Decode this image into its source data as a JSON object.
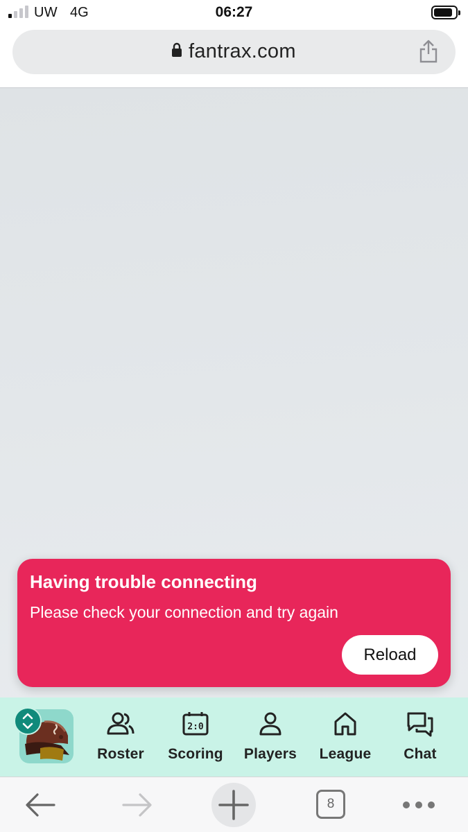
{
  "status_bar": {
    "carrier": "UW",
    "network": "4G",
    "time": "06:27",
    "signal_bars_active": 1,
    "signal_bars_total": 4,
    "battery_level": 0.85
  },
  "browser": {
    "url": "fantrax.com",
    "tab_count": "8"
  },
  "error_toast": {
    "title": "Having trouble connecting",
    "message": "Please check your connection and try again",
    "reload_label": "Reload",
    "color": "#e8265a"
  },
  "app_nav": {
    "background": "#c9f3e7",
    "items": [
      {
        "label": "Roster",
        "icon": "roster-icon"
      },
      {
        "label": "Scoring",
        "icon": "scoreboard-icon"
      },
      {
        "label": "Players",
        "icon": "person-icon"
      },
      {
        "label": "League",
        "icon": "home-icon"
      },
      {
        "label": "Chat",
        "icon": "chat-icon"
      }
    ]
  },
  "toolbar": {
    "icons": [
      "back-arrow-icon",
      "forward-arrow-icon",
      "plus-icon",
      "tabs-icon",
      "more-icon"
    ]
  }
}
